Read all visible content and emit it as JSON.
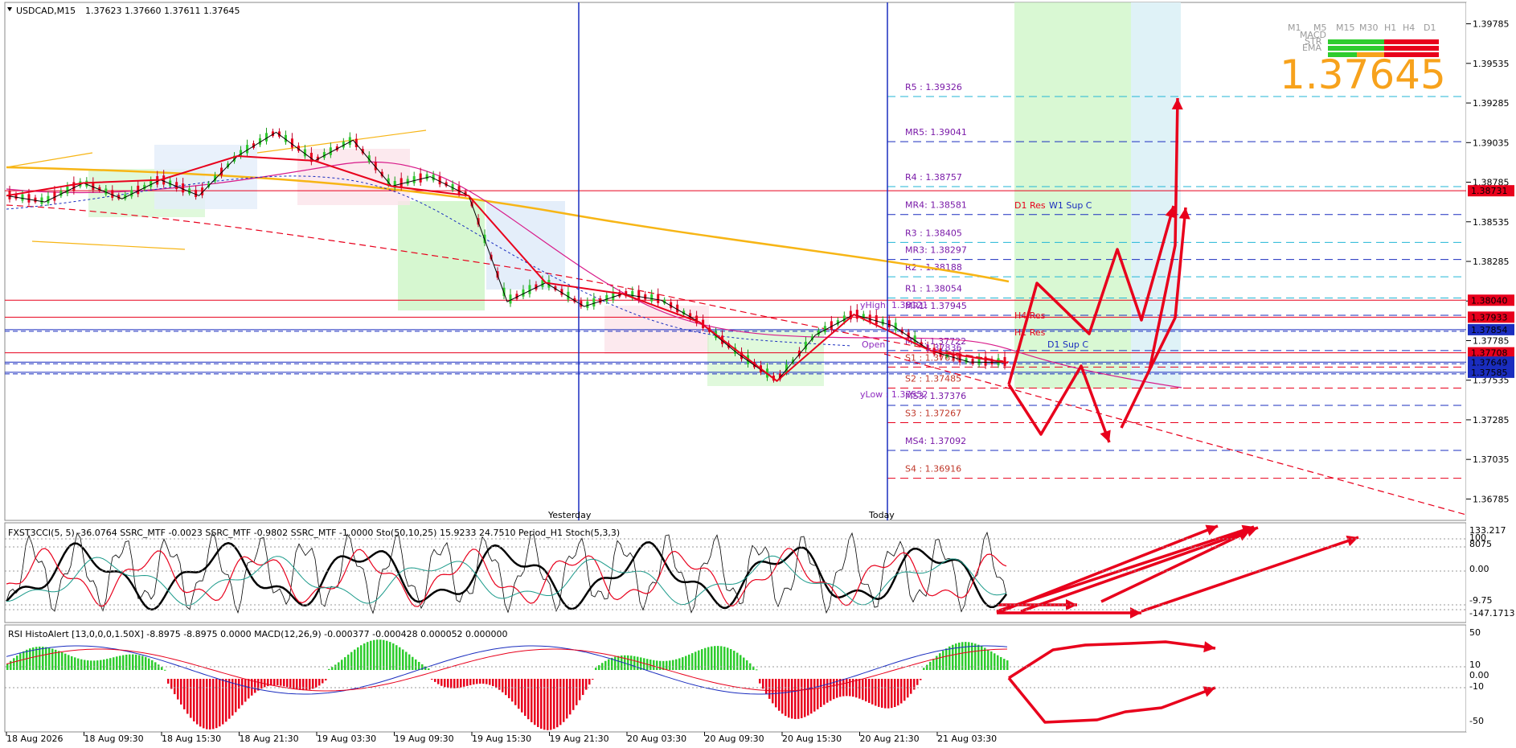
{
  "header": {
    "symbol": "USDCAD,M15",
    "ohlc": "1.37623 1.37660 1.37611 1.37645"
  },
  "big_price": "1.37645",
  "tf_labels": [
    "M1",
    "M5",
    "M15",
    "M30",
    "H1",
    "H4",
    "D1"
  ],
  "tf_row_labels": [
    "MACD",
    "STR",
    "EMA"
  ],
  "separators": {
    "yesterday": "Yesterday",
    "today": "Today"
  },
  "price_axis": [
    "1.39785",
    "1.39535",
    "1.39285",
    "1.39035",
    "1.38785",
    "1.38535",
    "1.38285",
    "1.38035",
    "1.37785",
    "1.37535",
    "1.37285",
    "1.37035",
    "1.36785"
  ],
  "price_tags": [
    {
      "text": "1.38731",
      "color": "#e8001c"
    },
    {
      "text": "1.38040",
      "color": "#e8001c"
    },
    {
      "text": "1.37933",
      "color": "#e8001c"
    },
    {
      "text": "1.37854",
      "color": "#1a2dbf"
    },
    {
      "text": "1.37708",
      "color": "#e8001c"
    },
    {
      "text": "1.37649",
      "color": "#1a2dbf"
    },
    {
      "text": "1.37585",
      "color": "#1a2dbf"
    }
  ],
  "pivots": [
    {
      "label": "R5 : 1.39326",
      "value": 1.39326,
      "color": "#22b6d6",
      "kind": "pivot"
    },
    {
      "label": "MR5: 1.39041",
      "value": 1.39041,
      "color": "#1a2dbf",
      "kind": "mid"
    },
    {
      "label": "R4 : 1.38757",
      "value": 1.38757,
      "color": "#22b6d6",
      "kind": "pivot"
    },
    {
      "label": "MR4: 1.38581",
      "value": 1.38581,
      "color": "#1a2dbf",
      "kind": "mid"
    },
    {
      "label": "R3 : 1.38405",
      "value": 1.38405,
      "color": "#22b6d6",
      "kind": "pivot"
    },
    {
      "label": "MR3: 1.38297",
      "value": 1.38297,
      "color": "#1a2dbf",
      "kind": "mid"
    },
    {
      "label": "R2 : 1.38188",
      "value": 1.38188,
      "color": "#22b6d6",
      "kind": "pivot"
    },
    {
      "label": "R1 : 1.38054",
      "value": 1.38054,
      "color": "#22b6d6",
      "kind": "pivot"
    },
    {
      "label": "MR1: 1.37945",
      "value": 1.37945,
      "color": "#1a2dbf",
      "kind": "mid"
    },
    {
      "label": "MS1: 1.37722",
      "value": 1.37722,
      "color": "#1a2dbf",
      "kind": "mid"
    },
    {
      "label": "S1 : 1.37618",
      "value": 1.37618,
      "color": "#e8001c",
      "kind": "pivot"
    },
    {
      "label": "S2 : 1.37485",
      "value": 1.37485,
      "color": "#e8001c",
      "kind": "pivot"
    },
    {
      "label": "MS3: 1.37376",
      "value": 1.37376,
      "color": "#1a2dbf",
      "kind": "mid"
    },
    {
      "label": "S3 : 1.37267",
      "value": 1.37267,
      "color": "#e8001c",
      "kind": "pivot"
    },
    {
      "label": "MS4: 1.37092",
      "value": 1.37092,
      "color": "#1a2dbf",
      "kind": "mid"
    },
    {
      "label": "S4 : 1.36916",
      "value": 1.36916,
      "color": "#e8001c",
      "kind": "pivot"
    }
  ],
  "annotations": {
    "d1_res": "D1 Res",
    "w1_sup": "W1 Sup C",
    "h4_res": "H4 Res",
    "h1_res": "H1 Res",
    "d1_sup": "D1 Sup C",
    "yhigh": "yHigh: 1.38121",
    "ylow": "yLow : 1.37552",
    "open": "Open",
    "open_val": "1.37836"
  },
  "indicator1": {
    "label": "FXST3CCI(5, 5) -36.0764  SSRC_MTF -0.0023  SSRC_MTF -0.9802  SSRC_MTF -1.0000  Sto(50,10,25) 15.9233 24.7510  Period_H1 Stoch(5,3,3)",
    "axis": [
      "133.217",
      "100",
      "8075",
      "0.00",
      "-9.75",
      "-147.1713"
    ]
  },
  "indicator2": {
    "label": "RSI HistoAlert [13,0,0,0,1.50X] -8.8975 -8.8975 0.0000  MACD(12,26,9) -0.000377 -0.000428 0.000052 0.000000",
    "axis": [
      "50",
      "10",
      "0.00",
      "-10",
      "-50"
    ]
  },
  "time_axis": [
    "18 Aug 2026",
    "18 Aug 09:30",
    "18 Aug 15:30",
    "18 Aug 21:30",
    "19 Aug 03:30",
    "19 Aug 09:30",
    "19 Aug 15:30",
    "19 Aug 21:30",
    "20 Aug 03:30",
    "20 Aug 09:30",
    "20 Aug 15:30",
    "20 Aug 21:30",
    "21 Aug 03:30"
  ],
  "chart_data": {
    "type": "line",
    "title": "USDCAD,M15",
    "ylim": [
      1.3665,
      1.3992
    ],
    "close_series": [
      {
        "x": "18 Aug 00:00",
        "y": 1.387
      },
      {
        "x": "18 Aug 03:00",
        "y": 1.3866
      },
      {
        "x": "18 Aug 06:00",
        "y": 1.3878
      },
      {
        "x": "18 Aug 09:00",
        "y": 1.3868
      },
      {
        "x": "18 Aug 12:00",
        "y": 1.388
      },
      {
        "x": "18 Aug 15:00",
        "y": 1.387
      },
      {
        "x": "18 Aug 18:00",
        "y": 1.3895
      },
      {
        "x": "18 Aug 21:00",
        "y": 1.391
      },
      {
        "x": "19 Aug 00:00",
        "y": 1.3892
      },
      {
        "x": "19 Aug 03:00",
        "y": 1.3905
      },
      {
        "x": "19 Aug 06:00",
        "y": 1.3876
      },
      {
        "x": "19 Aug 09:00",
        "y": 1.3882
      },
      {
        "x": "19 Aug 12:00",
        "y": 1.387
      },
      {
        "x": "19 Aug 15:00",
        "y": 1.3803
      },
      {
        "x": "19 Aug 18:00",
        "y": 1.3815
      },
      {
        "x": "19 Aug 21:00",
        "y": 1.38
      },
      {
        "x": "20 Aug 00:00",
        "y": 1.3808
      },
      {
        "x": "20 Aug 03:00",
        "y": 1.3804
      },
      {
        "x": "20 Aug 06:00",
        "y": 1.379
      },
      {
        "x": "20 Aug 09:00",
        "y": 1.377
      },
      {
        "x": "20 Aug 12:00",
        "y": 1.3753
      },
      {
        "x": "20 Aug 15:00",
        "y": 1.3782
      },
      {
        "x": "20 Aug 18:00",
        "y": 1.3795
      },
      {
        "x": "20 Aug 21:00",
        "y": 1.3788
      },
      {
        "x": "21 Aug 00:00",
        "y": 1.3772
      },
      {
        "x": "21 Aug 03:00",
        "y": 1.3765
      },
      {
        "x": "21 Aug 05:00",
        "y": 1.37645
      }
    ],
    "horizontal_lines": [
      1.38731,
      1.3804,
      1.37933,
      1.37854,
      1.37708,
      1.37649,
      1.37585
    ]
  }
}
